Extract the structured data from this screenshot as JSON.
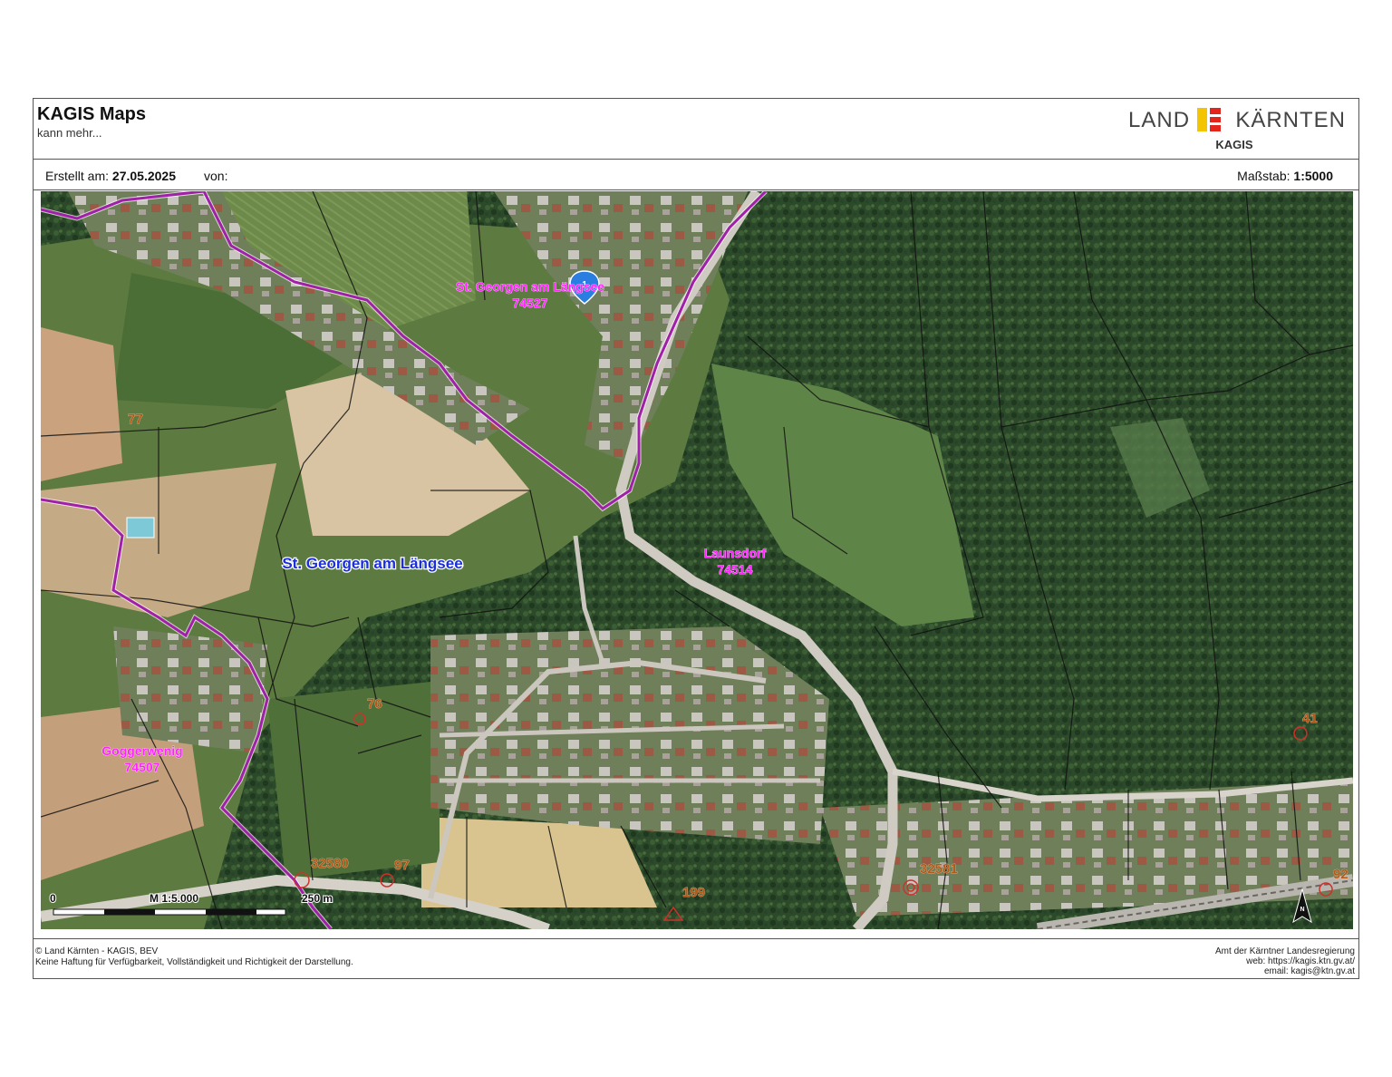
{
  "header": {
    "title": "KAGIS Maps",
    "subtitle": "kann mehr...",
    "logo_left": "LAND",
    "logo_right": "KÄRNTEN",
    "logo_sub": "KAGIS"
  },
  "info": {
    "created_label": "Erstellt am:",
    "created_date": "27.05.2025",
    "by_label": "von:",
    "scale_label": "Maßstab:",
    "scale_value": "1:5000"
  },
  "map": {
    "municipality_labels": [
      {
        "name": "St. Georgen am Längsee",
        "code": "74527"
      },
      {
        "name": "Launsdorf",
        "code": "74514"
      },
      {
        "name": "Goggerwenig",
        "code": "74507"
      }
    ],
    "town_label": "St. Georgen am Längsee",
    "parcel_numbers": [
      "77",
      "76",
      "41",
      "32580",
      "97",
      "199",
      "32581",
      "92"
    ],
    "marker_label": "1",
    "scalebar": {
      "zero": "0",
      "ratio": "M 1:5.000",
      "distance": "250 m"
    },
    "north_arrow_letter": "N",
    "colors": {
      "boundary": "#a020a8",
      "municipality_label": "#ff22ff",
      "town_label": "#1a2ee0",
      "parcel_number": "#b3591a",
      "marker": "#2a7de1"
    }
  },
  "footer": {
    "left_line1": "© Land Kärnten - KAGIS, BEV",
    "left_line2": "Keine Haftung für Verfügbarkeit, Vollständigkeit und Richtigkeit der Darstellung.",
    "right_line1": "Amt der Kärntner Landesregierung",
    "right_line2": "web: https://kagis.ktn.gv.at/",
    "right_line3": "email: kagis@ktn.gv.at"
  }
}
